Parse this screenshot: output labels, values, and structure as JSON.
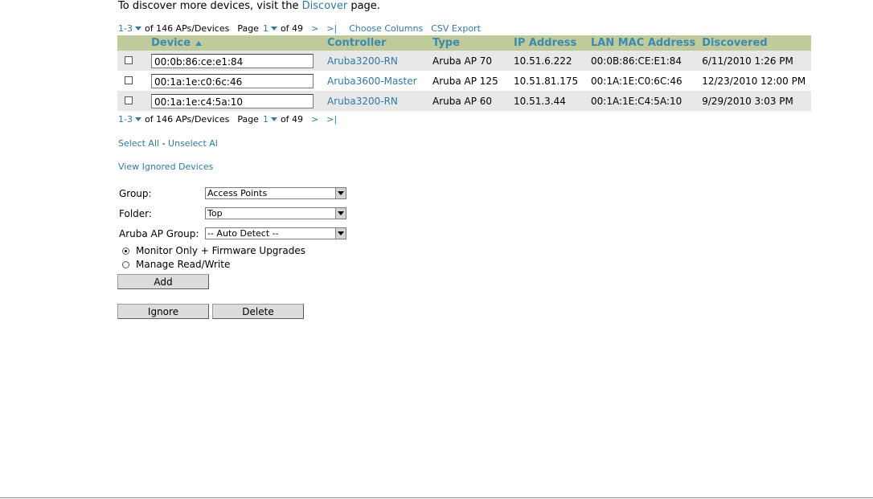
{
  "intro": {
    "prefix": "To discover more devices, visit the ",
    "link": "Discover",
    "suffix": " page."
  },
  "pager": {
    "range": "1-3",
    "of_total": "of 146 APs/Devices",
    "page_label": "Page",
    "page": "1",
    "of_pages": "of 49",
    "next": ">",
    "last": ">|",
    "choose_columns": "Choose Columns",
    "csv_export": "CSV Export"
  },
  "table": {
    "headers": [
      "Device",
      "Controller",
      "Type",
      "IP Address",
      "LAN MAC Address",
      "Discovered"
    ],
    "sort_column": "Device",
    "rows": [
      {
        "device": "00:0b:86:ce:e1:84",
        "controller": "Aruba3200-RN",
        "type": "Aruba AP 70",
        "ip": "10.51.6.222",
        "mac": "00:0B:86:CE:E1:84",
        "discovered": "6/11/2010 1:26 PM"
      },
      {
        "device": "00:1a:1e:c0:6c:46",
        "controller": "Aruba3600-Master",
        "type": "Aruba AP 125",
        "ip": "10.51.81.175",
        "mac": "00:1A:1E:C0:6C:46",
        "discovered": "12/23/2010 12:00 PM"
      },
      {
        "device": "00:1a:1e:c4:5a:10",
        "controller": "Aruba3200-RN",
        "type": "Aruba AP 60",
        "ip": "10.51.3.44",
        "mac": "00:1A:1E:C4:5A:10",
        "discovered": "9/29/2010 3:03 PM"
      }
    ]
  },
  "selection": {
    "select_all": "Select All",
    "separator": " - ",
    "unselect_all": "Unselect Al"
  },
  "view_ignored": "View Ignored Devices",
  "form": {
    "group_label": "Group:",
    "group_value": "Access Points",
    "folder_label": "Folder:",
    "folder_value": "Top",
    "ap_group_label": "Aruba AP Group:",
    "ap_group_value": "-- Auto Detect --",
    "radio_monitor": "Monitor Only + Firmware Upgrades",
    "radio_manage": "Manage Read/Write",
    "add_button": "Add",
    "ignore_button": "Ignore",
    "delete_button": "Delete"
  },
  "colors": {
    "link": "#2e7aa3",
    "header_bg": "#bfcb9b",
    "header_text": "#3b8ab3",
    "row_alt": "#e8e8e8"
  }
}
